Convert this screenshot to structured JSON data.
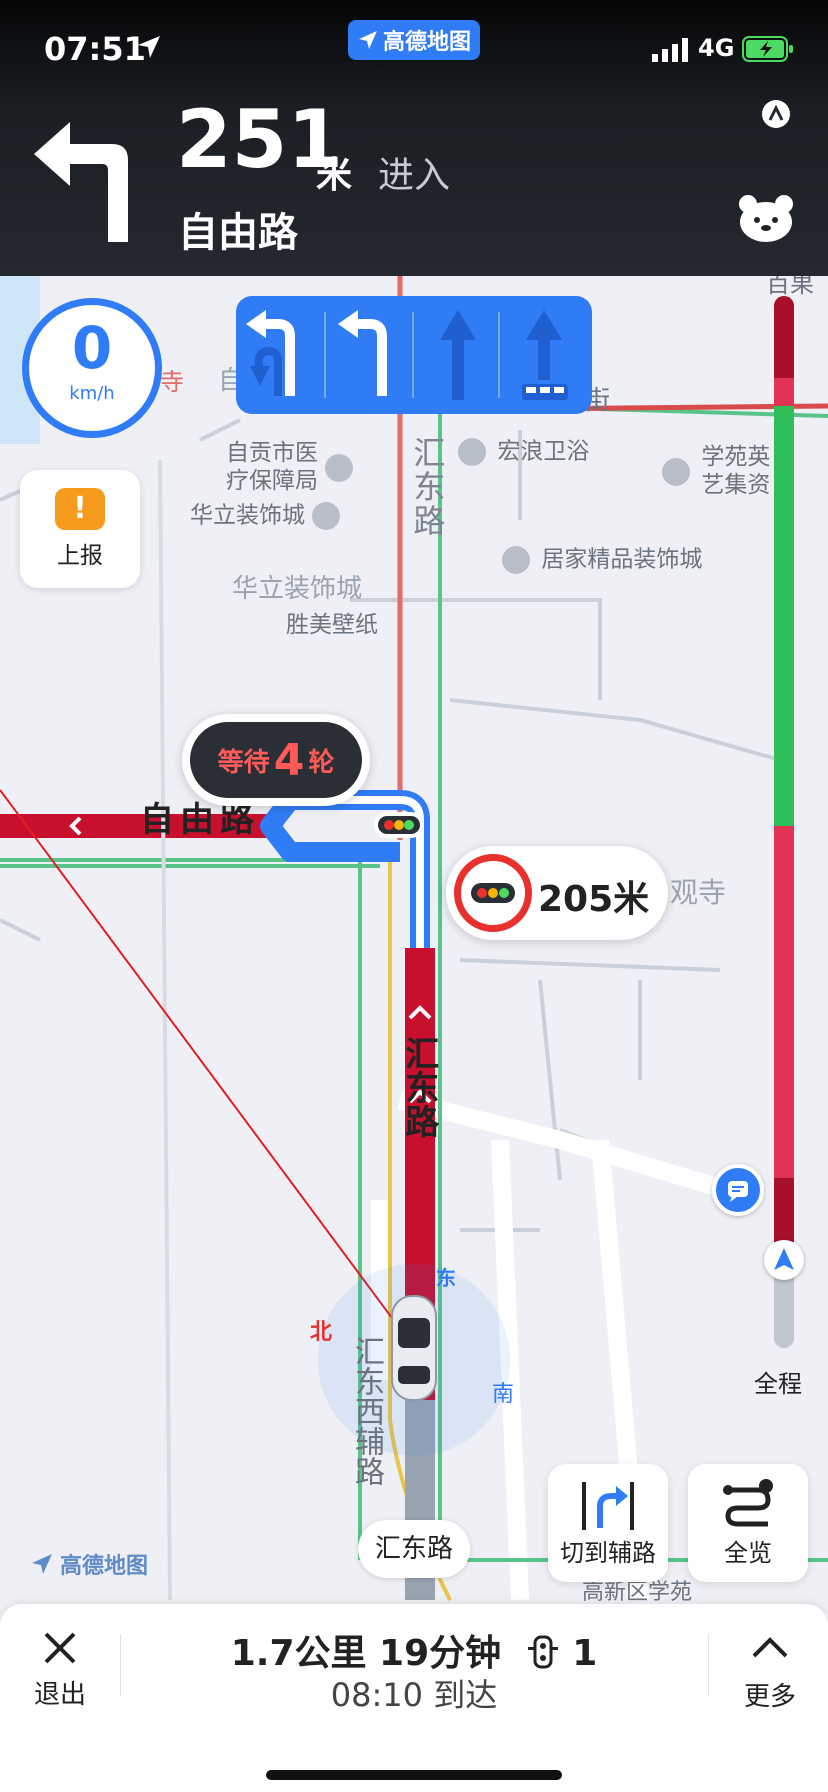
{
  "status_bar": {
    "time": "07:51",
    "app_badge": "高德地图",
    "network": "4G"
  },
  "navigation": {
    "turn_icon": "turn-left-arrow",
    "distance": "251",
    "distance_unit": "米",
    "action": "进入",
    "road": "自由路"
  },
  "speed": {
    "value": "0",
    "unit": "km/h"
  },
  "lane_guidance": [
    "left-turn-or-uturn",
    "left-turn",
    "straight",
    "straight-bus"
  ],
  "report_button": {
    "label": "上报",
    "icon": "exclamation-icon"
  },
  "map_labels": {
    "poi_1": "自贡市医\n疗保障局",
    "poi_2": "宏浪卫浴",
    "poi_3": "学苑英\n艺集资",
    "poi_4": "华立装饰城",
    "poi_5": "居家精品装饰城",
    "poi_6": "华立装饰城",
    "poi_7": "胜美壁纸",
    "road_1": "汇东路",
    "road_2": "自由路",
    "road_3": "汇东路",
    "road_4": "汇东西辅路",
    "poi_8": "观寺",
    "poi_9": "高新区学苑",
    "partial_1": "寺",
    "partial_2": "自",
    "partial_3": "街",
    "partial_4": "百果"
  },
  "traffic_light_wait": {
    "prefix": "等待",
    "rounds": "4",
    "suffix": "轮"
  },
  "traffic_light_distance": "205米",
  "compass": {
    "north": "北",
    "east": "东",
    "south": "南"
  },
  "route_progress_label": "全程",
  "watermark": "高德地图",
  "current_road": "汇东路",
  "buttons": {
    "switch_road": "切到辅路",
    "overview": "全览"
  },
  "bottom_bar": {
    "exit": "退出",
    "summary": "1.7公里 19分钟",
    "traffic_lights": "1",
    "arrival": "08:10 到达",
    "more": "更多"
  },
  "colors": {
    "brand_blue": "#2f7cf6",
    "congestion_red": "#c8102e",
    "smooth_green": "#2ebd59",
    "warning_orange": "#f79b1f"
  }
}
